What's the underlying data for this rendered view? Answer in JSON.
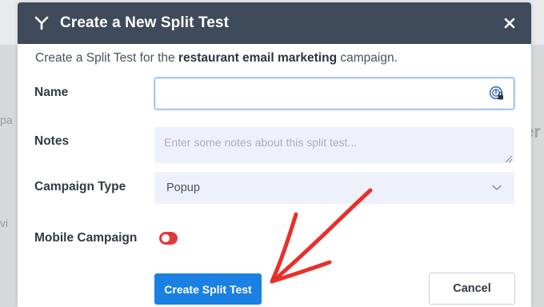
{
  "background": {
    "fragment_left_1": "pa",
    "fragment_left_2": "vi",
    "fragment_right_1": "er"
  },
  "modal": {
    "title": "Create a New Split Test",
    "logo_icon": "split-y-icon",
    "close_icon": "close-icon",
    "header_color": "#3f4a5a",
    "intro_prefix": "Create a Split Test for the ",
    "intro_campaign": "restaurant email marketing",
    "intro_suffix": " campaign."
  },
  "form": {
    "name_label": "Name",
    "name_value": "",
    "notes_label": "Notes",
    "notes_placeholder": "Enter some notes about this split test...",
    "campaign_type_label": "Campaign Type",
    "campaign_type_value": "Popup",
    "mobile_label": "Mobile Campaign",
    "mobile_enabled": false,
    "toggle_color": "#e03a3a"
  },
  "actions": {
    "create_label": "Create Split Test",
    "cancel_label": "Cancel",
    "primary_color": "#1a80e1"
  },
  "annotation": {
    "arrow_color": "#e8302b"
  }
}
